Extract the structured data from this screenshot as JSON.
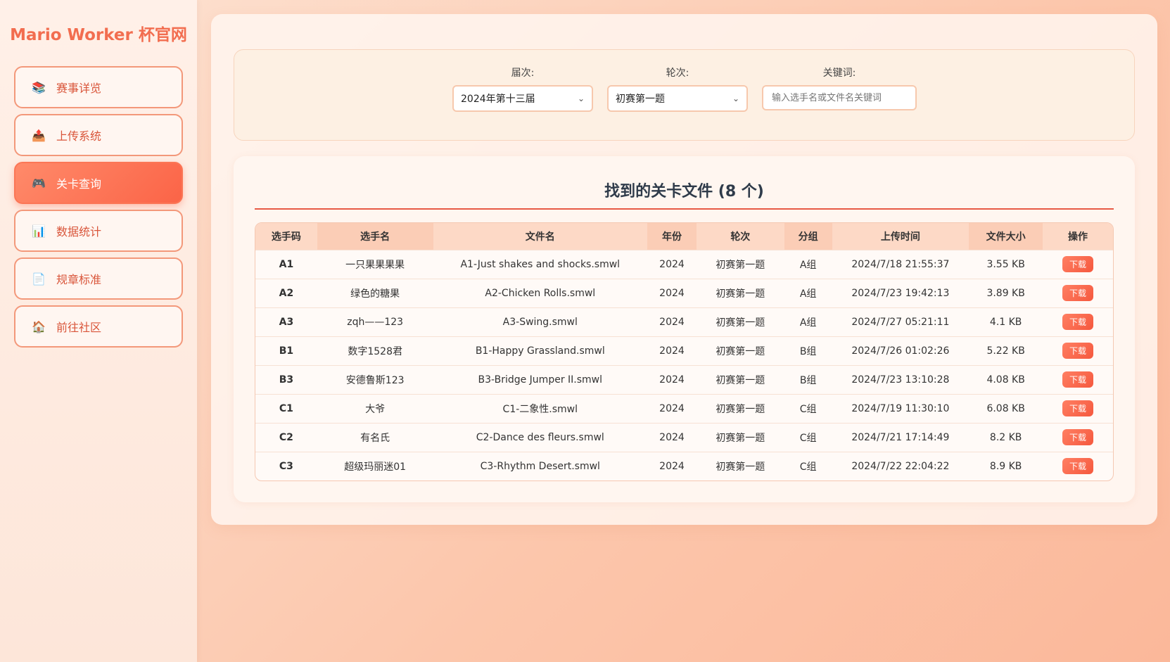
{
  "sidebar": {
    "brand": "Mario Worker 杯官网",
    "items": [
      {
        "label": "赛事详览",
        "icon": "books-icon",
        "glyph": "📚"
      },
      {
        "label": "上传系统",
        "icon": "upload-icon",
        "glyph": "📤"
      },
      {
        "label": "关卡查询",
        "icon": "gamepad-icon",
        "glyph": "🎮",
        "active": true
      },
      {
        "label": "数据统计",
        "icon": "bar-chart-icon",
        "glyph": "📊"
      },
      {
        "label": "规章标准",
        "icon": "document-icon",
        "glyph": "📄"
      },
      {
        "label": "前往社区",
        "icon": "house-icon",
        "glyph": "🏠"
      }
    ]
  },
  "filters": {
    "session_label": "届次:",
    "session_value": "2024年第十三届",
    "round_label": "轮次:",
    "round_value": "初赛第一题",
    "keyword_label": "关键词:",
    "keyword_placeholder": "输入选手名或文件名关键词",
    "keyword_value": ""
  },
  "results": {
    "title": "找到的关卡文件 (8 个)",
    "columns": [
      "选手码",
      "选手名",
      "文件名",
      "年份",
      "轮次",
      "分组",
      "上传时间",
      "文件大小",
      "操作"
    ],
    "rows": [
      {
        "code": "A1",
        "name": "一只果果果果",
        "file": "A1-Just shakes and shocks.smwl",
        "year": "2024",
        "round": "初赛第一题",
        "group": "A组",
        "time": "2024/7/18 21:55:37",
        "size": "3.55 KB",
        "action": "下载"
      },
      {
        "code": "A2",
        "name": "绿色的糖果",
        "file": "A2-Chicken Rolls.smwl",
        "year": "2024",
        "round": "初赛第一题",
        "group": "A组",
        "time": "2024/7/23 19:42:13",
        "size": "3.89 KB",
        "action": "下载"
      },
      {
        "code": "A3",
        "name": "zqh——123",
        "file": "A3-Swing.smwl",
        "year": "2024",
        "round": "初赛第一题",
        "group": "A组",
        "time": "2024/7/27 05:21:11",
        "size": "4.1 KB",
        "action": "下载"
      },
      {
        "code": "B1",
        "name": "数字1528君",
        "file": "B1-Happy Grassland.smwl",
        "year": "2024",
        "round": "初赛第一题",
        "group": "B组",
        "time": "2024/7/26 01:02:26",
        "size": "5.22 KB",
        "action": "下载"
      },
      {
        "code": "B3",
        "name": "安德鲁斯123",
        "file": "B3-Bridge Jumper II.smwl",
        "year": "2024",
        "round": "初赛第一题",
        "group": "B组",
        "time": "2024/7/23 13:10:28",
        "size": "4.08 KB",
        "action": "下载"
      },
      {
        "code": "C1",
        "name": "大爷",
        "file": "C1-二象性.smwl",
        "year": "2024",
        "round": "初赛第一题",
        "group": "C组",
        "time": "2024/7/19 11:30:10",
        "size": "6.08 KB",
        "action": "下载"
      },
      {
        "code": "C2",
        "name": "有名氏",
        "file": "C2-Dance des fleurs.smwl",
        "year": "2024",
        "round": "初赛第一题",
        "group": "C组",
        "time": "2024/7/21 17:14:49",
        "size": "8.2 KB",
        "action": "下载"
      },
      {
        "code": "C3",
        "name": "超级玛丽迷01",
        "file": "C3-Rhythm Desert.smwl",
        "year": "2024",
        "round": "初赛第一题",
        "group": "C组",
        "time": "2024/7/22 22:04:22",
        "size": "8.9 KB",
        "action": "下载"
      }
    ]
  },
  "colors": {
    "accent": "#f26d4f",
    "active_nav": "#fb6447",
    "title_rule": "#e85a45"
  }
}
